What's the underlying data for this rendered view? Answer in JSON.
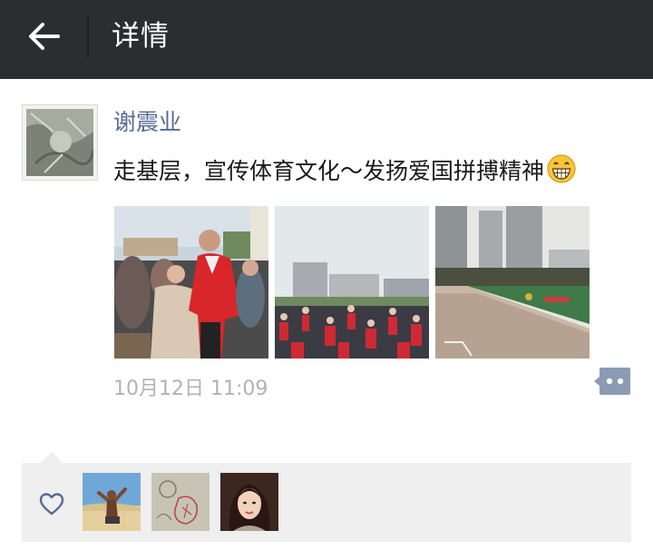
{
  "header": {
    "title": "详情",
    "back_icon": "arrow-left-icon",
    "background": "#2b2e31"
  },
  "post": {
    "author": "谢震业",
    "text": "走基层，宣传体育文化～发扬爱国拼搏精神",
    "emoji": "grinning-face-emoji",
    "timestamp": "10月12日 11:09",
    "name_color": "#576b95",
    "photos": [
      {
        "label": "athlete-with-crowd-photo"
      },
      {
        "label": "crowd-at-sports-field-photo"
      },
      {
        "label": "empty-sports-field-photo"
      }
    ],
    "action_icon": "comment-dots-icon"
  },
  "likes": {
    "icon": "heart-outline-icon",
    "avatars": [
      {
        "label": "liker-avatar-beach"
      },
      {
        "label": "liker-avatar-drawing"
      },
      {
        "label": "liker-avatar-woman"
      }
    ],
    "background": "#efefef"
  }
}
